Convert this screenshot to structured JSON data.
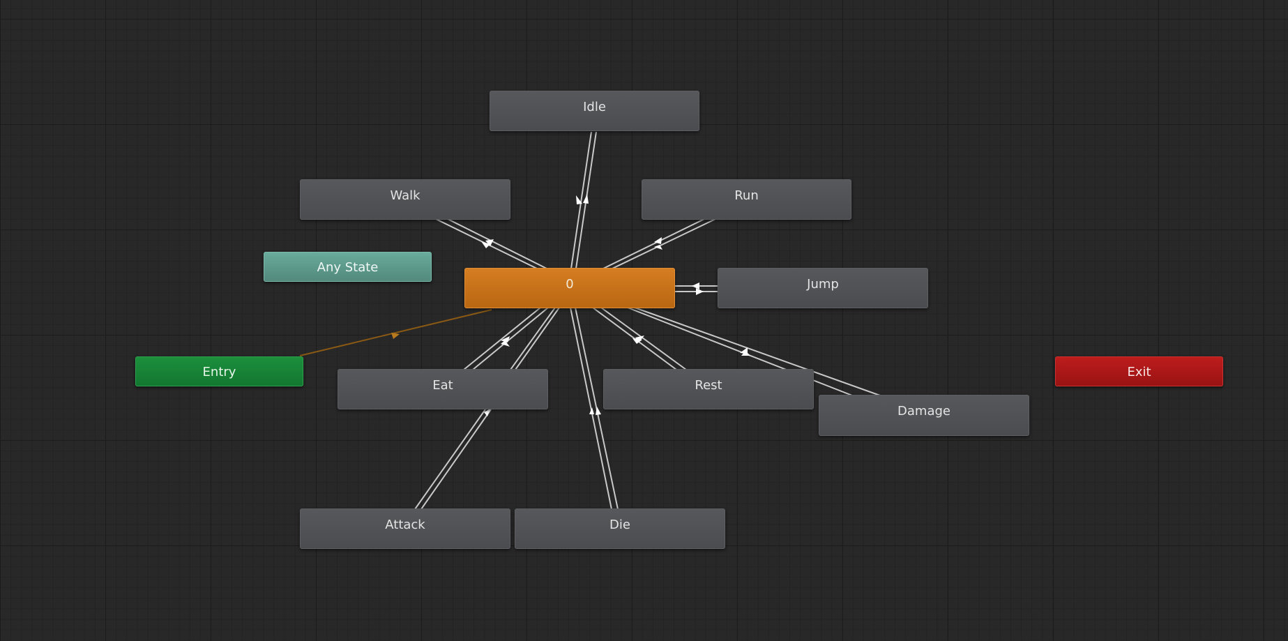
{
  "graph": {
    "states": {
      "idle": "Idle",
      "walk": "Walk",
      "run": "Run",
      "any_state": "Any State",
      "default_state": "0",
      "jump": "Jump",
      "entry": "Entry",
      "eat": "Eat",
      "rest": "Rest",
      "damage": "Damage",
      "exit": "Exit",
      "attack": "Attack",
      "die": "Die"
    },
    "colors": {
      "canvas_background": "#282828",
      "state_node": "#505256",
      "default_state_node": "#c87218",
      "any_state_node": "#5e9c8e",
      "entry_node": "#178535",
      "exit_node": "#ab1717",
      "transition_line": "#cfcfcf",
      "default_transition_line": "#8a5a14"
    }
  }
}
